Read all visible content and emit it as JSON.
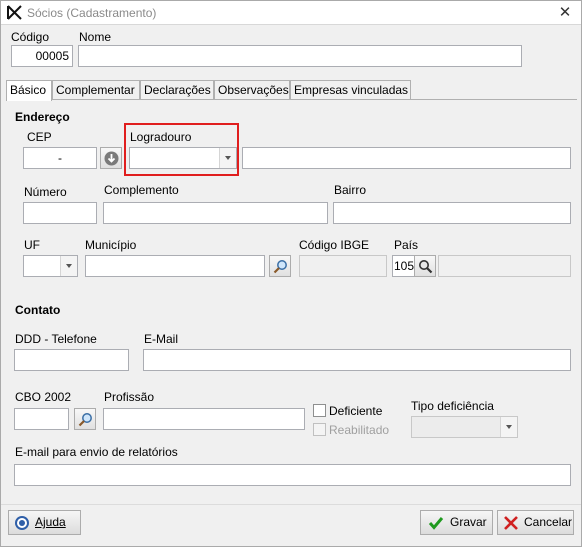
{
  "window": {
    "title": "Sócios (Cadastramento)",
    "close_label": "✕"
  },
  "header": {
    "codigo_label": "Código",
    "codigo_value": "00005",
    "nome_label": "Nome",
    "nome_value": ""
  },
  "tabs": [
    {
      "label": "Básico",
      "active": true
    },
    {
      "label": "Complementar"
    },
    {
      "label": "Declarações"
    },
    {
      "label": "Observações"
    },
    {
      "label": "Empresas vinculadas"
    }
  ],
  "endereco": {
    "section_label": "Endereço",
    "cep_label": "CEP",
    "cep_value": "-",
    "logradouro_label": "Logradouro",
    "logradouro_value": "",
    "numero_label": "Número",
    "complemento_label": "Complemento",
    "bairro_label": "Bairro",
    "uf_label": "UF",
    "municipio_label": "Município",
    "codigo_ibge_label": "Código IBGE",
    "pais_label": "País",
    "pais_value": "105"
  },
  "contato": {
    "section_label": "Contato",
    "ddd_label": "DDD - Telefone",
    "email_label": "E-Mail",
    "cbo_label": "CBO 2002",
    "profissao_label": "Profissão",
    "deficiente_label": "Deficiente",
    "reabilitado_label": "Reabilitado",
    "tipo_deficiencia_label": "Tipo deficiência",
    "email_relatorios_label": "E-mail para envio de relatórios"
  },
  "buttons": {
    "ajuda_label": "Ajuda",
    "gravar_label": "Gravar",
    "cancelar_label": "Cancelar"
  },
  "icons": {
    "cep_lookup": "circle-arrow-down-icon",
    "search": "magnifier-icon",
    "help": "help-icon",
    "save": "checkmark-icon",
    "cancel": "x-icon"
  },
  "colors": {
    "highlight": "#e01e1e",
    "save_check": "#1f9a1f",
    "cancel_x": "#d02020"
  }
}
